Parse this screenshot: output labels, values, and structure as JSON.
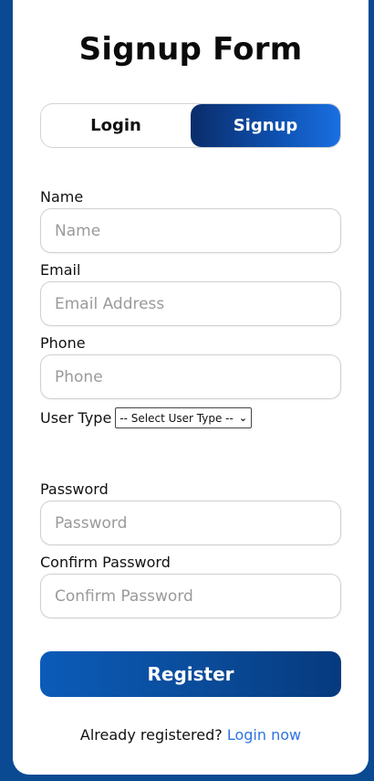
{
  "form": {
    "title": "Signup Form",
    "tabs": [
      {
        "label": "Login",
        "active": false
      },
      {
        "label": "Signup",
        "active": true
      }
    ],
    "fields": {
      "name": {
        "label": "Name",
        "placeholder": "Name",
        "value": ""
      },
      "email": {
        "label": "Email",
        "placeholder": "Email Address",
        "value": ""
      },
      "phone": {
        "label": "Phone",
        "placeholder": "Phone",
        "value": ""
      },
      "user_type": {
        "label": "User Type",
        "selected": "-- Select User Type --"
      },
      "password": {
        "label": "Password",
        "placeholder": "Password",
        "value": ""
      },
      "confirm_password": {
        "label": "Confirm Password",
        "placeholder": "Confirm Password",
        "value": ""
      }
    },
    "register_label": "Register",
    "footer": {
      "text": "Already registered?",
      "link_label": "Login now"
    }
  },
  "colors": {
    "background": "#0a4a93",
    "accent": "#0d4fae",
    "link": "#2f73e0"
  }
}
